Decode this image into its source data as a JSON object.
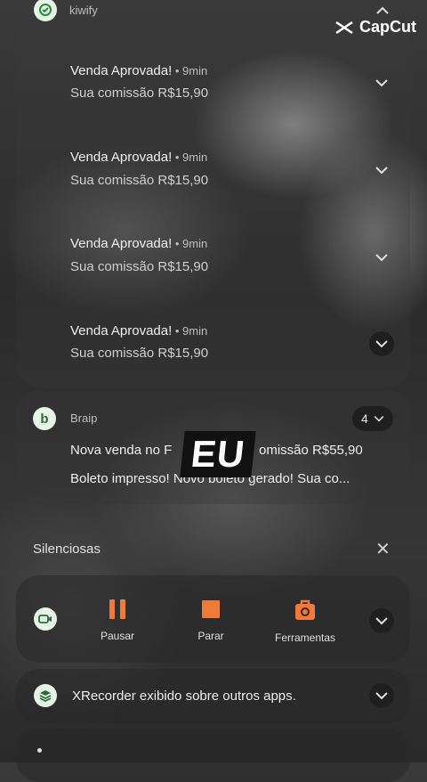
{
  "capcut": {
    "label": "CapCut"
  },
  "kiwify": {
    "app_name": "kiwify",
    "notifications": [
      {
        "title": "Venda Aprovada!",
        "time": "9min",
        "subtitle": "Sua comissão R$15,90"
      },
      {
        "title": "Venda Aprovada!",
        "time": "9min",
        "subtitle": "Sua comissão R$15,90"
      },
      {
        "title": "Venda Aprovada!",
        "time": "9min",
        "subtitle": "Sua comissão R$15,90"
      },
      {
        "title": "Venda Aprovada!",
        "time": "9min",
        "subtitle": "Sua comissão R$15,90"
      }
    ]
  },
  "braip": {
    "app_name": "Braip",
    "count": "4",
    "line1": "Nova venda no F",
    "line1_end": "omissão R$55,90",
    "line2": "Boleto impresso! Novo boleto gerado! Sua co..."
  },
  "overlay": {
    "text": "EU"
  },
  "silent": {
    "label": "Silenciosas"
  },
  "recorder": {
    "actions": [
      {
        "label": "Pausar",
        "icon": "pause-icon"
      },
      {
        "label": "Parar",
        "icon": "stop-icon"
      },
      {
        "label": "Ferramentas",
        "icon": "toolbox-icon"
      }
    ]
  },
  "xrecorder": {
    "text": "XRecorder exibido sobre outros apps."
  },
  "colors": {
    "accent": "#f07a3a",
    "icon_bg": "#e6f3e6"
  }
}
